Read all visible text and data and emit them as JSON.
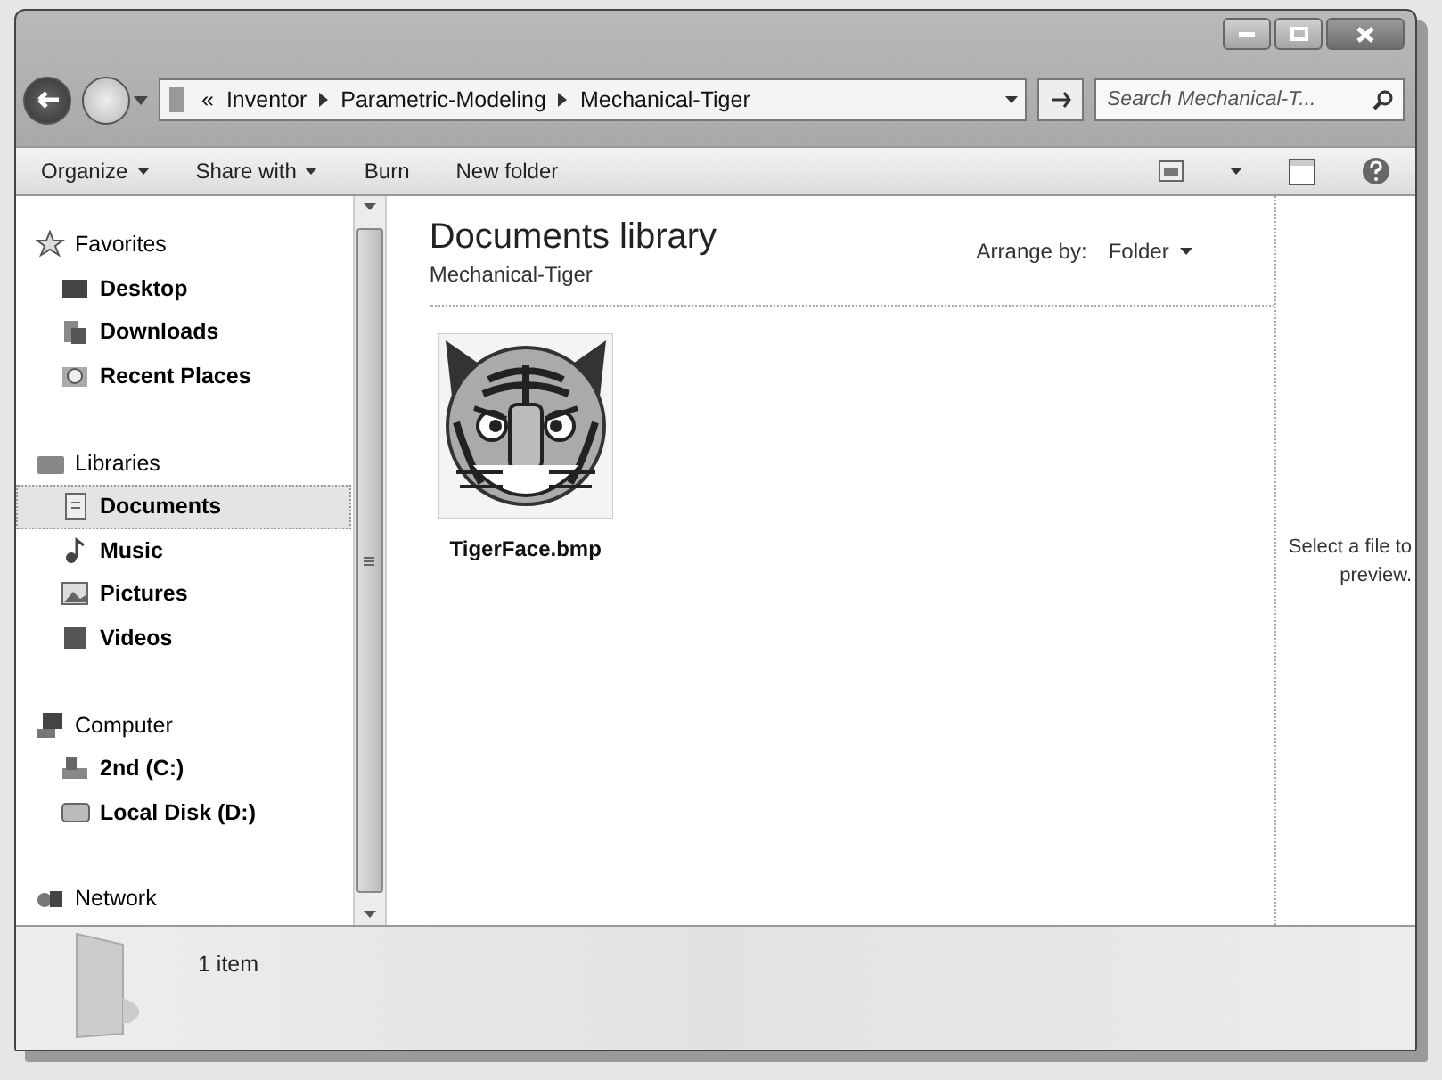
{
  "address_bar": {
    "overflow": "«",
    "segments": [
      {
        "label": "Inventor"
      },
      {
        "label": "Parametric-Modeling"
      },
      {
        "label": "Mechanical-Tiger"
      }
    ]
  },
  "search": {
    "placeholder": "Search Mechanical-T..."
  },
  "toolbar": {
    "buttons": [
      {
        "label": "Organize",
        "dropdown": true
      },
      {
        "label": "Share with",
        "dropdown": true
      },
      {
        "label": "Burn",
        "dropdown": false
      },
      {
        "label": "New folder",
        "dropdown": false
      }
    ]
  },
  "navigation": {
    "groups": [
      {
        "label": "Favorites",
        "children": [
          {
            "label": "Desktop",
            "selected": false
          },
          {
            "label": "Downloads",
            "selected": false
          },
          {
            "label": "Recent Places",
            "selected": false
          }
        ]
      },
      {
        "label": "Libraries",
        "children": [
          {
            "label": "Documents",
            "selected": true
          },
          {
            "label": "Music",
            "selected": false
          },
          {
            "label": "Pictures",
            "selected": false
          },
          {
            "label": "Videos",
            "selected": false
          }
        ]
      },
      {
        "label": "Computer",
        "children": [
          {
            "label": "2nd (C:)",
            "selected": false
          },
          {
            "label": "Local Disk (D:)",
            "selected": false
          }
        ]
      },
      {
        "label": "Network"
      }
    ]
  },
  "library": {
    "title": "Documents library",
    "subtitle": "Mechanical-Tiger",
    "arrange_label": "Arrange by:",
    "arrange_value": "Folder"
  },
  "files": [
    {
      "name": "TigerFace.bmp",
      "selected": false
    }
  ],
  "preview": {
    "message": "Select a file to preview."
  },
  "details": {
    "count": "1 item"
  }
}
